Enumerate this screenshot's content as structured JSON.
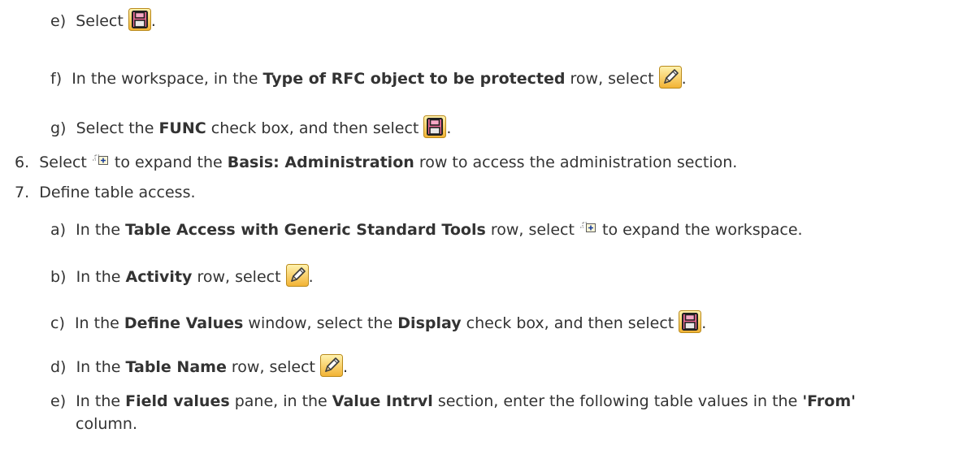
{
  "steps": [
    {
      "id": "s1",
      "marker": "e)",
      "parts": [
        {
          "t": "text",
          "v": "Select "
        },
        {
          "t": "icon",
          "icon": "save-icon"
        },
        {
          "t": "text",
          "v": "."
        }
      ]
    },
    {
      "id": "s2",
      "marker": "f)",
      "parts": [
        {
          "t": "text",
          "v": "In the workspace, in the "
        },
        {
          "t": "bold",
          "v": "Type of RFC object to be protected"
        },
        {
          "t": "text",
          "v": " row, select "
        },
        {
          "t": "icon",
          "icon": "pencil-icon"
        },
        {
          "t": "text",
          "v": "."
        }
      ]
    },
    {
      "id": "s3",
      "marker": "g)",
      "parts": [
        {
          "t": "text",
          "v": "Select the "
        },
        {
          "t": "bold",
          "v": "FUNC"
        },
        {
          "t": "text",
          "v": " check box, and then select "
        },
        {
          "t": "icon",
          "icon": "save-icon"
        },
        {
          "t": "text",
          "v": "."
        }
      ]
    },
    {
      "id": "s4",
      "marker": "6.",
      "parts": [
        {
          "t": "text",
          "v": "Select "
        },
        {
          "t": "icon",
          "icon": "expand-icon"
        },
        {
          "t": "text",
          "v": " to expand the "
        },
        {
          "t": "bold",
          "v": "Basis: Administration"
        },
        {
          "t": "text",
          "v": " row to access the administration section."
        }
      ]
    },
    {
      "id": "s5",
      "marker": "7.",
      "parts": [
        {
          "t": "text",
          "v": "Define table access."
        }
      ]
    },
    {
      "id": "s6",
      "marker": "a)",
      "parts": [
        {
          "t": "text",
          "v": "In the "
        },
        {
          "t": "bold",
          "v": "Table Access with Generic Standard Tools"
        },
        {
          "t": "text",
          "v": " row, select "
        },
        {
          "t": "icon",
          "icon": "expand-icon"
        },
        {
          "t": "text",
          "v": " to expand the workspace."
        }
      ]
    },
    {
      "id": "s7",
      "marker": "b)",
      "parts": [
        {
          "t": "text",
          "v": "In the "
        },
        {
          "t": "bold",
          "v": "Activity"
        },
        {
          "t": "text",
          "v": " row, select "
        },
        {
          "t": "icon",
          "icon": "pencil-icon"
        },
        {
          "t": "text",
          "v": "."
        }
      ]
    },
    {
      "id": "s8",
      "marker": "c)",
      "parts": [
        {
          "t": "text",
          "v": "In the "
        },
        {
          "t": "bold",
          "v": "Define Values"
        },
        {
          "t": "text",
          "v": " window, select the "
        },
        {
          "t": "bold",
          "v": "Display"
        },
        {
          "t": "text",
          "v": " check box, and then select "
        },
        {
          "t": "icon",
          "icon": "save-icon"
        },
        {
          "t": "text",
          "v": "."
        }
      ]
    },
    {
      "id": "s9",
      "marker": "d)",
      "parts": [
        {
          "t": "text",
          "v": "In the "
        },
        {
          "t": "bold",
          "v": "Table Name"
        },
        {
          "t": "text",
          "v": " row, select "
        },
        {
          "t": "icon",
          "icon": "pencil-icon"
        },
        {
          "t": "text",
          "v": "."
        }
      ]
    },
    {
      "id": "s10",
      "marker": "e)",
      "parts": [
        {
          "t": "text",
          "v": "In the "
        },
        {
          "t": "bold",
          "v": "Field values"
        },
        {
          "t": "text",
          "v": " pane, in the "
        },
        {
          "t": "bold",
          "v": "Value Intrvl"
        },
        {
          "t": "text",
          "v": " section, enter the following table values in the "
        },
        {
          "t": "bold",
          "v": "'From'"
        }
      ]
    },
    {
      "id": "s11",
      "marker": "",
      "parts": [
        {
          "t": "text",
          "v": "column."
        }
      ]
    }
  ]
}
